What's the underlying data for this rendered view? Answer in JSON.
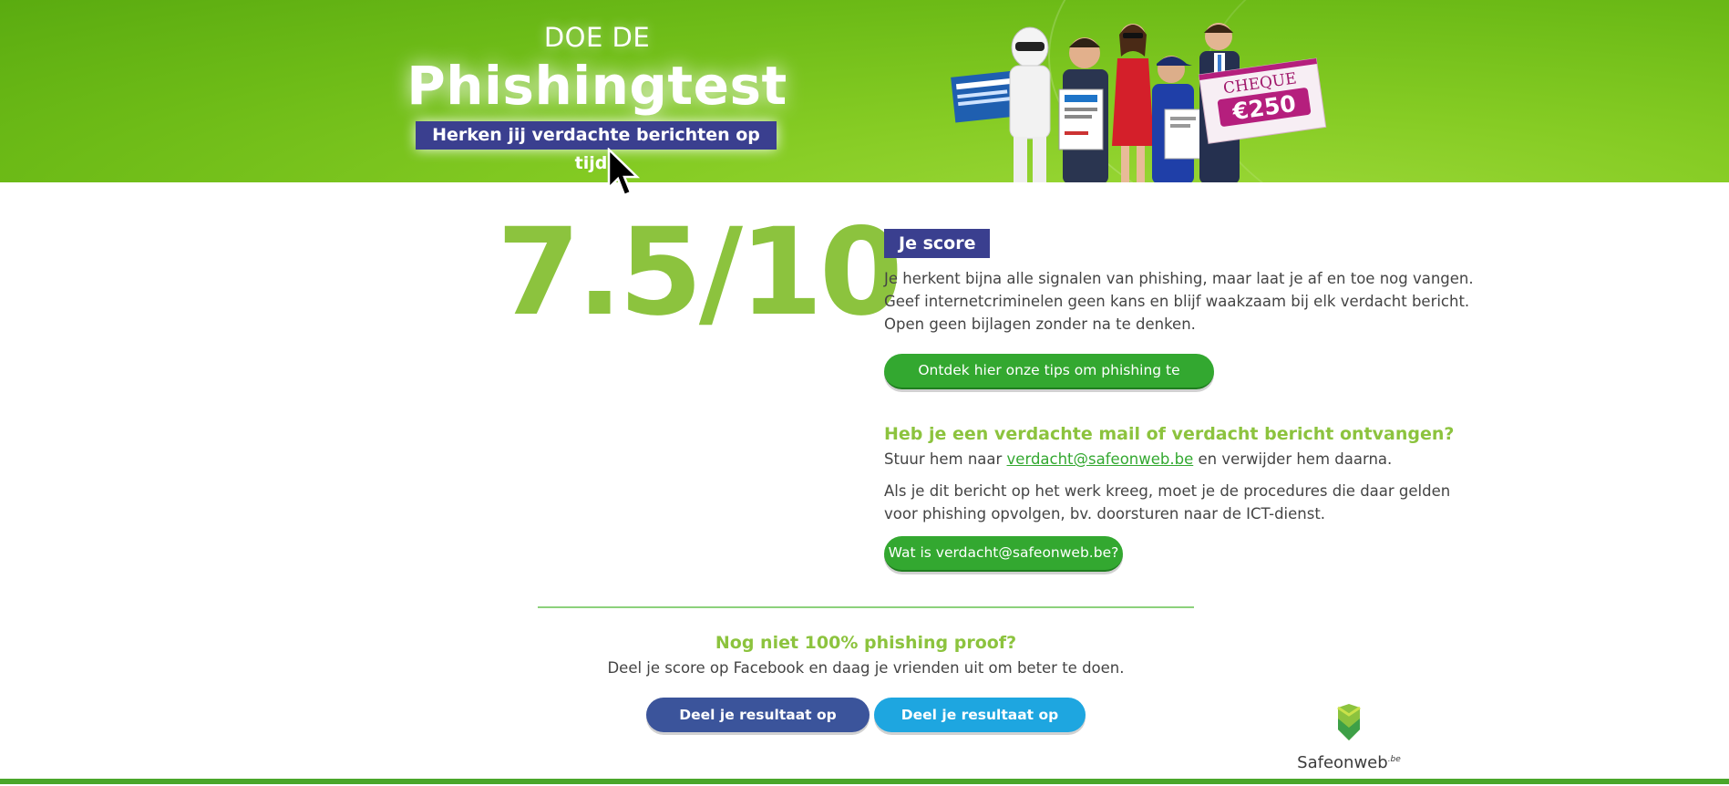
{
  "banner": {
    "kicker": "DOE DE",
    "headline": "Phishingtest",
    "tagline": "Herken jij verdachte berichten op tijd?",
    "cheque_label": "CHEQUE",
    "cheque_amount": "€250"
  },
  "result": {
    "score": "7.5/10",
    "badge": "Je score",
    "description_lines": [
      "Je herkent bijna alle signalen van phishing, maar laat je af en toe nog vangen.",
      "Geef internetcriminelen geen kans en blijf waakzaam bij elk verdacht bericht.",
      "Open geen bijlagen zonder na te denken."
    ],
    "tips_button": "Ontdek hier onze tips om phishing te herkennen"
  },
  "report": {
    "heading": "Heb je een verdachte mail of verdacht bericht ontvangen?",
    "line_prefix": "Stuur hem naar ",
    "email": "verdacht@safeonweb.be",
    "line_suffix": " en verwijder hem daarna.",
    "work_lines": [
      "Als je dit bericht op het werk kreeg, moet je de procedures die daar gelden",
      "voor phishing opvolgen, bv. doorsturen naar de ICT-dienst."
    ],
    "info_button": "Wat is verdacht@safeonweb.be?"
  },
  "share": {
    "heading": "Nog niet 100% phishing proof?",
    "text": "Deel je score op Facebook en daag je vrienden uit om beter te doen.",
    "facebook_button": "Deel je resultaat op Facebook",
    "twitter_button": "Deel je resultaat op Twitter"
  },
  "logo": {
    "text_main": "Safeonweb",
    "text_sup": ".be"
  },
  "colors": {
    "brand_green": "#8cc33e",
    "button_green": "#33a830",
    "navy": "#3a3f8f",
    "facebook": "#3b549b",
    "twitter": "#1ea6e0"
  }
}
